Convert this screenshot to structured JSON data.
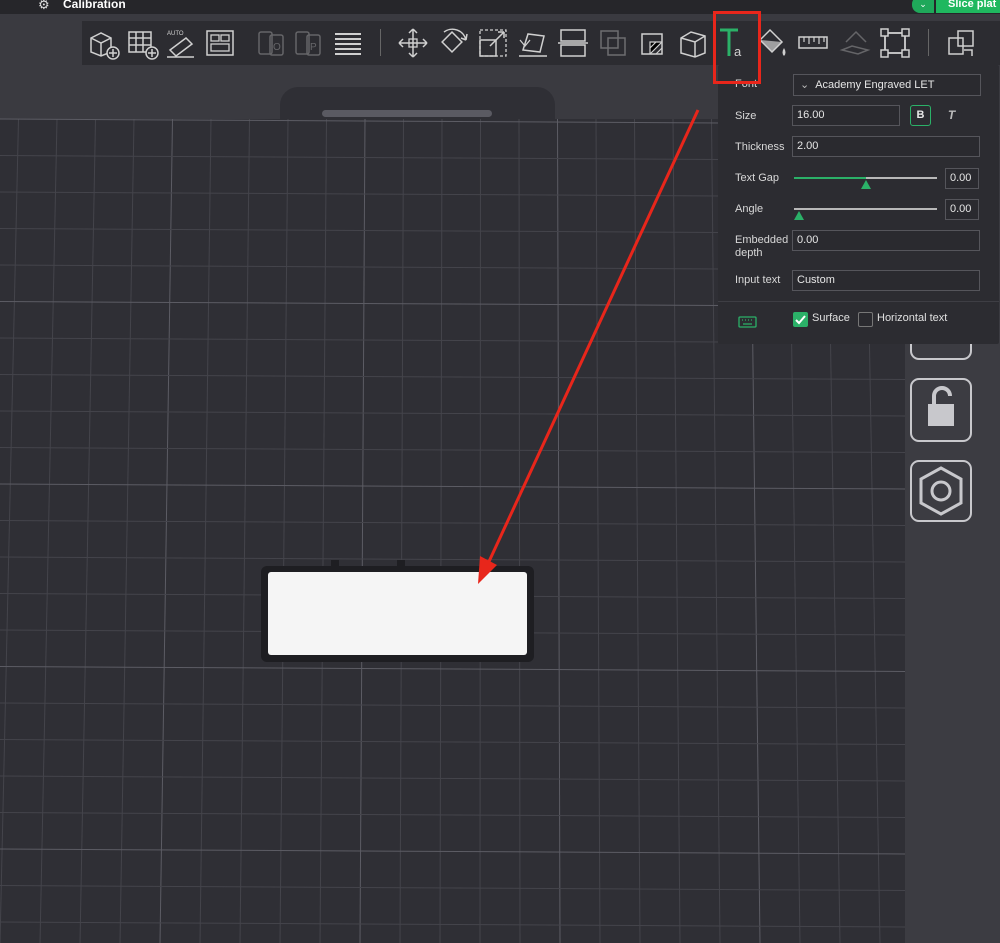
{
  "window": {
    "title": "Calibration",
    "slice_button_label": "Slice plat",
    "settings_icon": "gear-icon"
  },
  "colors": {
    "accent_green": "#2bb168",
    "highlight_red": "#e8261b",
    "plate_dark": "#2f2f35",
    "toolbar_bg": "#2c2c31"
  },
  "toolbar": {
    "icons": [
      "add-object-icon",
      "add-plate-icon",
      "auto-orient-icon",
      "arrange-icon",
      "split-objects-icon",
      "split-parts-icon",
      "layers-icon",
      "move-icon",
      "rotate-icon",
      "scale-icon",
      "lay-on-face-icon",
      "cut-icon",
      "boolean-icon",
      "support-paint-icon",
      "seam-paint-icon",
      "text-tool-icon",
      "color-paint-icon",
      "measure-icon",
      "assembly-icon",
      "fit-icon",
      "assemble-view-icon"
    ]
  },
  "text_panel": {
    "font_label": "Font",
    "font_value": "Academy Engraved LET",
    "size_label": "Size",
    "size_value": "16.00",
    "bold_label": "B",
    "italic_label": "T",
    "thickness_label": "Thickness",
    "thickness_value": "2.00",
    "text_gap_label": "Text Gap",
    "text_gap_value": "0.00",
    "text_gap_fraction": 0.5,
    "angle_label": "Angle",
    "angle_value": "0.00",
    "angle_fraction": 0.0,
    "embedded_label": "Embedded\ndepth",
    "embedded_value": "0.00",
    "input_text_label": "Input text",
    "input_text_value": "Custom",
    "surface_label": "Surface",
    "surface_checked": true,
    "horizontal_label": "Horizontal text",
    "horizontal_checked": false,
    "keyboard_icon": "keyboard-icon"
  },
  "side_panel": {
    "icons": [
      "split-plate-icon",
      "lock-icon",
      "settings-nut-icon"
    ]
  }
}
